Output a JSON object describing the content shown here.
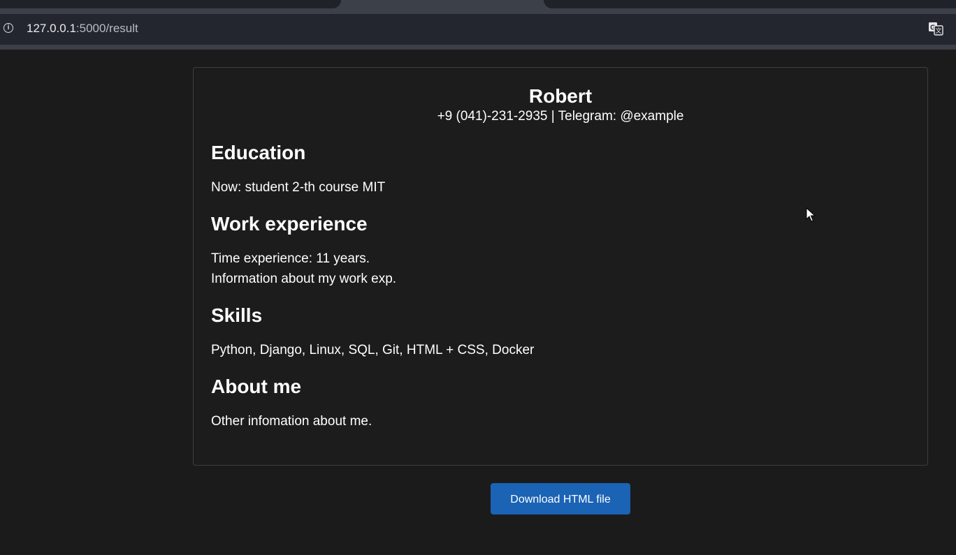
{
  "browser": {
    "url_host": "127.0.0.1",
    "url_path": ":5000/result",
    "info_icon": "info-icon",
    "translate_icon": "translate-icon"
  },
  "resume": {
    "name": "Robert",
    "contact": "+9 (041)-231-2935 | Telegram: @example",
    "sections": [
      {
        "heading": "Education",
        "lines": [
          "Now: student 2-th course MIT"
        ]
      },
      {
        "heading": "Work experience",
        "lines": [
          "Time experience: 11 years.",
          "Information about my work exp."
        ]
      },
      {
        "heading": "Skills",
        "lines": [
          "Python, Django, Linux, SQL, Git, HTML + CSS, Docker"
        ]
      },
      {
        "heading": "About me",
        "lines": [
          "Other infomation about me."
        ]
      }
    ]
  },
  "download_button": {
    "label": "Download HTML file"
  },
  "colors": {
    "background": "#1b1b1b",
    "button": "#1a63b5",
    "text": "#ffffff"
  }
}
